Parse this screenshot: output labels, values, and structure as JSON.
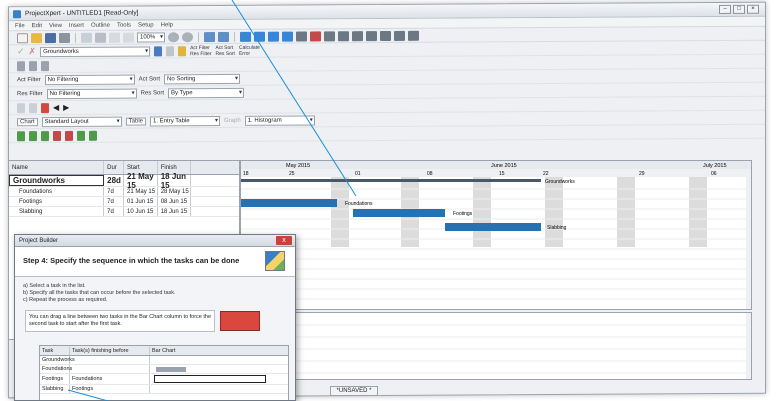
{
  "window": {
    "title": "ProjectXpert - UNTITLED1 [Read-Only]"
  },
  "menu": [
    "File",
    "Edit",
    "View",
    "Insert",
    "Outline",
    "Tools",
    "Setup",
    "Help"
  ],
  "toolbar": {
    "zoom": "100%"
  },
  "task_row": {
    "task_value": "Groundworks"
  },
  "radios": [
    "Act Filter",
    "Res Filter",
    "Act Sort",
    "Res Sort",
    "Calculate",
    "Error"
  ],
  "filters": {
    "act_filter_label": "Act Filter",
    "act_filter_value": "No Filtering",
    "act_sort_label": "Act Sort",
    "act_sort_value": "No Sorting",
    "res_filter_label": "Res Filter",
    "res_filter_value": "No Filtering",
    "res_sort_label": "Res Sort",
    "res_sort_value": "By Type"
  },
  "layout_row": {
    "chart_label": "Chart",
    "chart_value": "Standard Layout",
    "table_label": "Table",
    "table_value": "1. Entry Table",
    "graph_label": "Graph",
    "graph_value": "1. Histogram"
  },
  "table": {
    "headers": [
      "Name",
      "Dur",
      "Start",
      "Finish"
    ],
    "rows": [
      {
        "name": "Groundworks",
        "dur": "28d",
        "start": "21 May 15",
        "finish": "18 Jun 15"
      },
      {
        "name": "Foundations",
        "dur": "7d",
        "start": "21 May 15",
        "finish": "28 May 15"
      },
      {
        "name": "Footings",
        "dur": "7d",
        "start": "01 Jun 15",
        "finish": "08 Jun 15"
      },
      {
        "name": "Slabbing",
        "dur": "7d",
        "start": "10 Jun 15",
        "finish": "18 Jun 15"
      }
    ]
  },
  "timescale": {
    "months": [
      "May 2015",
      "June 2015",
      "July 2015"
    ],
    "days": [
      "18",
      "25",
      "01",
      "08",
      "15",
      "22",
      "29",
      "06"
    ]
  },
  "bar_labels": {
    "groundworks": "Groundworks",
    "foundations": "Foundations",
    "footings": "Footings",
    "slabbing": "Slabbing"
  },
  "status": {
    "saved": "*UNSAVED *"
  },
  "dialog": {
    "title": "Project Builder",
    "close": "x",
    "step": "Step 4: Specify the sequence in which the tasks can be done",
    "instructions": [
      "a) Select a task in the list.",
      "b) Specify all the tasks that can occur before the selected task.",
      "c) Repeat the process as required."
    ],
    "note": "You can drag a line between two tasks in the Bar Chart column to force the second task to start after the first task.",
    "grid_headers": [
      "Task",
      "Task(s) finishing before",
      "Bar Chart"
    ],
    "grid_rows": [
      {
        "task": "Groundworks",
        "before": ""
      },
      {
        "task": "Foundations",
        "before": ""
      },
      {
        "task": "Footings",
        "before": "Foundations"
      },
      {
        "task": "Slabbing",
        "before": "Footings"
      }
    ]
  },
  "colors": {
    "accent": "#1a73b8",
    "bar": "#2670b4",
    "weekend": "#d9d9d9",
    "dialog_close": "#c8413a"
  }
}
